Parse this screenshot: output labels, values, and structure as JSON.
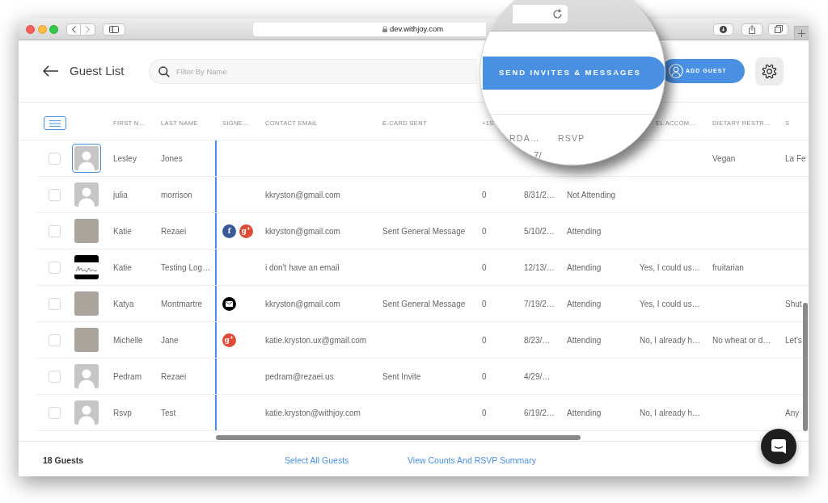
{
  "browser": {
    "url": "dev.withjoy.com"
  },
  "header": {
    "title": "Guest List",
    "search": {
      "placeholder": "Filter By Name"
    },
    "add_button": "ADD GUEST"
  },
  "magnifier": {
    "send_button": "SEND INVITES & MESSAGES",
    "column_labels": [
      "RDA…",
      "RSVP"
    ],
    "cell": "7/"
  },
  "table": {
    "columns": [
      "FIRST N…",
      "LAST NAME",
      "SIGNE…",
      "CONTACT EMAIL",
      "E-CARD SENT",
      "+1S",
      "EL ACCOM…",
      "DIETARY RESTR…",
      "S"
    ],
    "rows": [
      {
        "checked": false,
        "avatar": {
          "kind": "placeholder",
          "focused": true
        },
        "first_n": "Lesley",
        "last_name": "Jones",
        "dietary_restr": "Vegan",
        "column_13": "La Fe"
      },
      {
        "checked": false,
        "avatar": {
          "kind": "placeholder",
          "focused": false
        },
        "first_n": "julia",
        "last_name": "morrison",
        "contact_email": "kkryston@gmail.com",
        "plus_1s": "0",
        "column_8": "8/31/2…",
        "rsvp": "Not Attending"
      },
      {
        "checked": false,
        "avatar": {
          "kind": "photo",
          "focused": false
        },
        "first_n": "Katie",
        "last_name": "Rezaei",
        "signe": [
          {
            "kind": "letter",
            "glyph": "f",
            "color": "#3b5998"
          },
          {
            "kind": "letter",
            "glyph": "g$^{+}$",
            "color": "#dd4b39"
          }
        ],
        "contact_email": "kkryston@gmail.com",
        "e_card_sent": "Sent General Message",
        "plus_1s": "0",
        "column_8": "5/10/2…",
        "rsvp": "Attending"
      },
      {
        "checked": false,
        "avatar": {
          "kind": "logo",
          "focused": false
        },
        "first_n": "Katie",
        "last_name": "Testing Log…",
        "contact_email": "i don't have an email",
        "plus_1s": "0",
        "column_8": "12/13/…",
        "rsvp": "Attending",
        "el_accom": "Yes, I could us…",
        "dietary_restr": "fruitarian"
      },
      {
        "checked": false,
        "avatar": {
          "kind": "photo",
          "focused": false
        },
        "first_n": "Katya",
        "last_name": "Montmartre",
        "signe": [
          {
            "kind": "envelope",
            "color": "#000000"
          }
        ],
        "contact_email": "kkryston@gmail.com",
        "e_card_sent": "Sent General Message",
        "plus_1s": "0",
        "column_8": "7/19/2…",
        "rsvp": "Attending",
        "el_accom": "Yes, I could us…",
        "column_13": "Shut"
      },
      {
        "checked": false,
        "avatar": {
          "kind": "photo",
          "focused": false
        },
        "first_n": "Michelle",
        "last_name": "Jane",
        "signe": [
          {
            "kind": "letter",
            "glyph": "g$^{+}$",
            "color": "#dd4b39"
          }
        ],
        "contact_email": "katie.kryston.ux@gmail.com",
        "plus_1s": "0",
        "column_8": "8/23/…",
        "rsvp": "Attending",
        "el_accom": "No, I already h…",
        "dietary_restr": "No wheat or d…",
        "column_13": "Let's"
      },
      {
        "checked": false,
        "avatar": {
          "kind": "placeholder",
          "focused": false
        },
        "first_n": "Pedram",
        "last_name": "Rezaei",
        "contact_email": "pedram@rezaei.us",
        "e_card_sent": "Sent Invite",
        "plus_1s": "0",
        "column_8": "4/29/…"
      },
      {
        "checked": false,
        "avatar": {
          "kind": "placeholder",
          "focused": false
        },
        "first_n": "Rsvp",
        "last_name": "Test",
        "contact_email": "katie.kryston@withjoy.com",
        "plus_1s": "0",
        "column_8": "6/19/2…",
        "rsvp": "Attending",
        "el_accom": "No, I already h…",
        "column_13": "Any"
      }
    ]
  },
  "footer": {
    "count": "18 Guests",
    "links": [
      "Select All Guests",
      "View Counts And RSVP Summary"
    ]
  }
}
